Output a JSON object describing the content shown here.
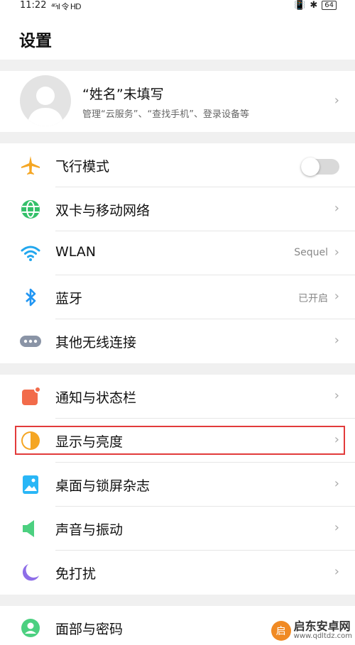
{
  "status_bar": {
    "time": "11:22",
    "signal": "⁴ᴳıl 令 HD",
    "battery": "64"
  },
  "page_title": "设置",
  "profile": {
    "name": "“姓名”未填写",
    "desc": "管理“云服务”、“查找手机”、登录设备等"
  },
  "chevron": "›",
  "rows": [
    {
      "label": "飞行模式",
      "icon": "airplane-icon",
      "color": "#f5a623"
    },
    {
      "label": "双卡与移动网络",
      "icon": "globe-icon",
      "color": "#34c06a"
    },
    {
      "label": "WLAN",
      "value": "Sequel",
      "icon": "wifi-icon",
      "color": "#22a7ee"
    },
    {
      "label": "蓝牙",
      "value": "已开启",
      "icon": "bluetooth-icon",
      "color": "#2196f3"
    },
    {
      "label": "其他无线连接",
      "icon": "more-connections-icon",
      "color": "#8a94a6"
    },
    {
      "label": "通知与状态栏",
      "icon": "notification-icon",
      "color": "#f26b4a"
    },
    {
      "label": "显示与亮度",
      "icon": "brightness-icon",
      "color": "#f5a623"
    },
    {
      "label": "桌面与锁屏杂志",
      "icon": "wallpaper-icon",
      "color": "#29b6f6"
    },
    {
      "label": "声音与振动",
      "icon": "sound-icon",
      "color": "#4cd080"
    },
    {
      "label": "免打扰",
      "icon": "moon-icon",
      "color": "#8e6ee8"
    },
    {
      "label": "面部与密码",
      "icon": "face-icon",
      "color": "#4cd080"
    }
  ],
  "watermark": {
    "logo": "启",
    "name": "启东安卓网",
    "url": "www.qdltdz.com"
  }
}
